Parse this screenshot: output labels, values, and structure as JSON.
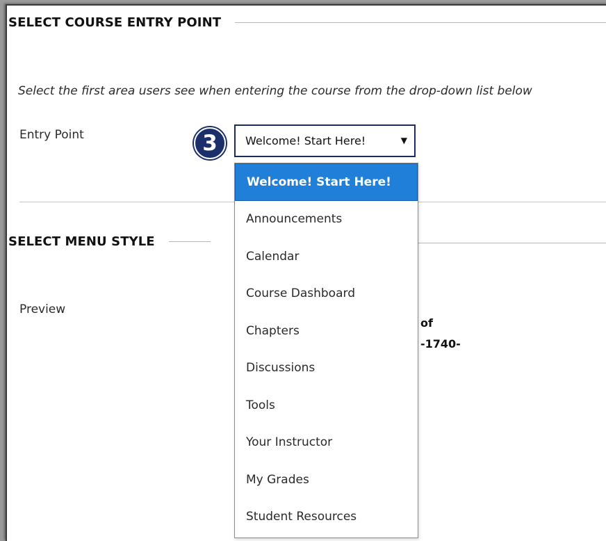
{
  "section_entry": {
    "title": "SELECT COURSE ENTRY POINT",
    "instructions": "Select the first area users see when entering the course from the drop-down list below",
    "entry_label": "Entry Point",
    "step_number": "3",
    "selected_value": "Welcome! Start Here!",
    "dropdown_arrow": "▼",
    "options": [
      "Welcome! Start Here!",
      "Announcements",
      "Calendar",
      "Course Dashboard",
      "Chapters",
      "Discussions",
      "Tools",
      "Your Instructor",
      "My Grades",
      "Student Resources"
    ]
  },
  "section_menu": {
    "title": "SELECT MENU STYLE",
    "preview_label": "Preview",
    "preview_partial_line1": "of",
    "preview_partial_line2": "-1740-"
  },
  "colors": {
    "selected_option_bg": "#1f7fd9",
    "select_border": "#1d2a5c",
    "step_badge_bg": "#1b2f6b"
  },
  "icons": {
    "step_badge": "step-3-badge-icon",
    "dropdown_arrow": "chevron-down-icon"
  }
}
